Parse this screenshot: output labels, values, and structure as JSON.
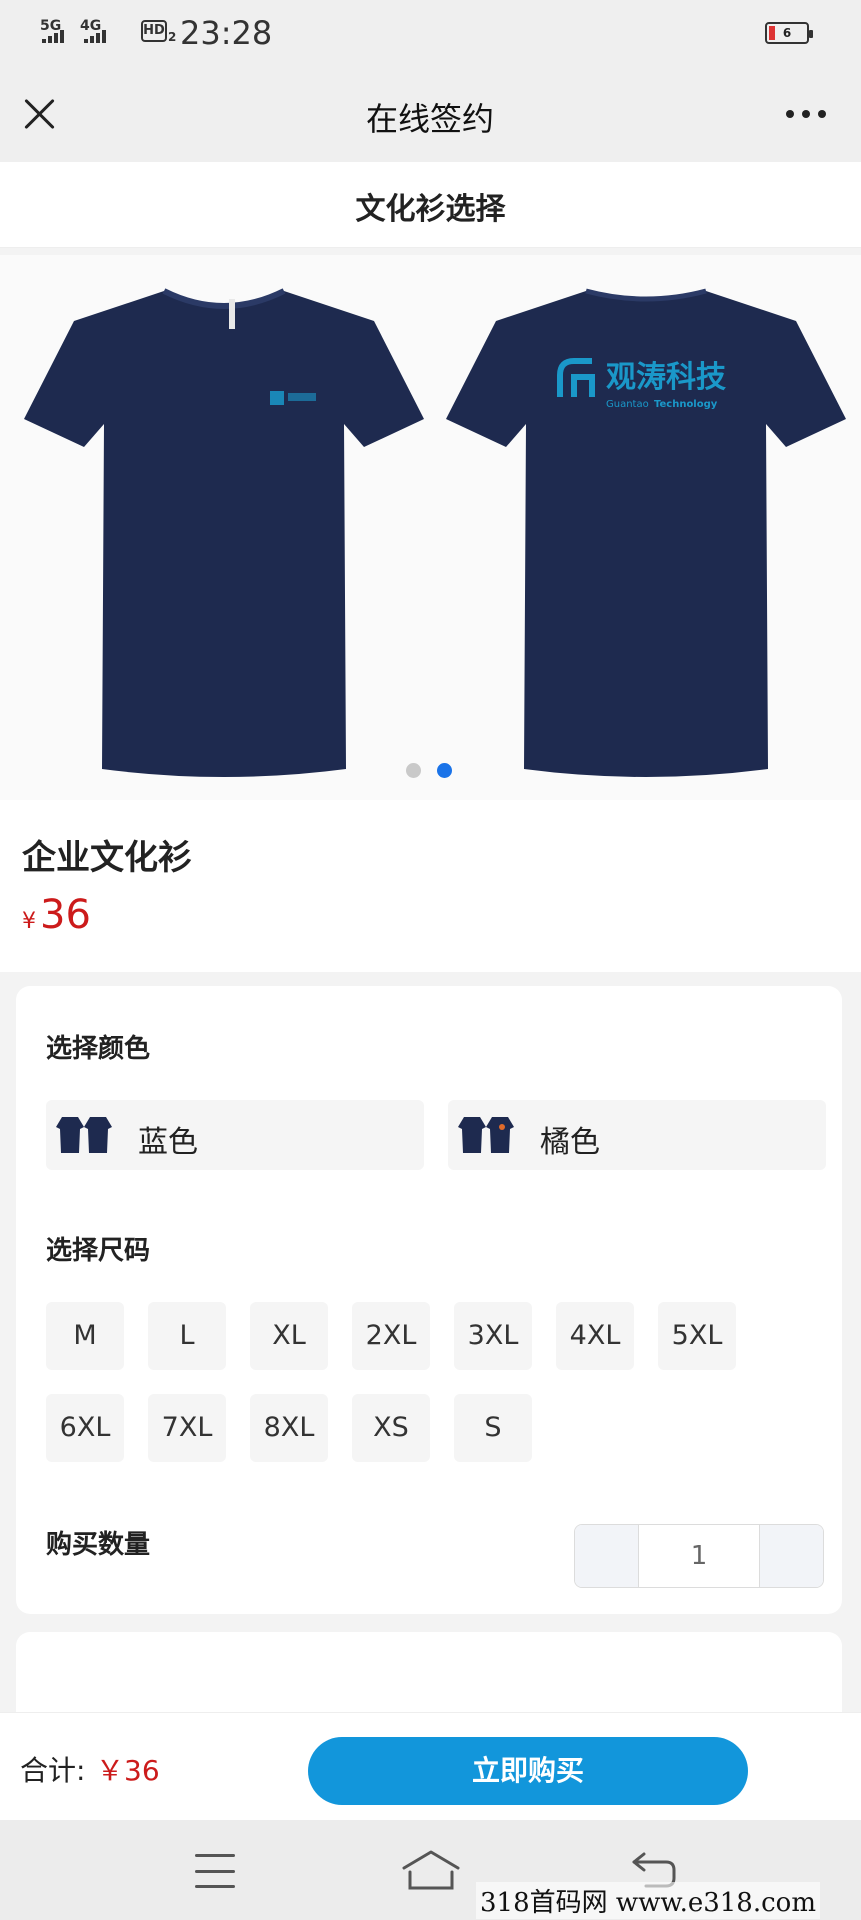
{
  "status_bar": {
    "network_1": "5G",
    "network_2": "4G",
    "hd_label": "HD",
    "hd_sub": "2",
    "time": "23:28",
    "battery_level": "6"
  },
  "nav": {
    "title": "在线签约",
    "close_icon": "close-icon",
    "more_icon": "more-dots-icon"
  },
  "section_title": "文化衫选择",
  "carousel": {
    "logo_text": "观涛科技",
    "logo_sub_a": "Guantao",
    "logo_sub_b": "Technology",
    "slide_count": 2,
    "active_slide": 2,
    "shirt_color": "#1e2a4f"
  },
  "product": {
    "name": "企业文化衫",
    "currency": "¥",
    "price": "36"
  },
  "options": {
    "color_label": "选择颜色",
    "colors": [
      {
        "label": "蓝色"
      },
      {
        "label": "橘色"
      }
    ],
    "size_label": "选择尺码",
    "sizes": [
      "M",
      "L",
      "XL",
      "2XL",
      "3XL",
      "4XL",
      "5XL",
      "6XL",
      "7XL",
      "8XL",
      "XS",
      "S"
    ],
    "quantity_label": "购买数量",
    "quantity": "1"
  },
  "footer": {
    "total_label": "合计:",
    "total_price": "￥36",
    "buy_label": "立即购买"
  },
  "system_nav": {
    "menu_icon": "menu-icon",
    "home_icon": "home-icon",
    "back_icon": "back-icon"
  },
  "watermark": "318首码网  www.e318.com",
  "colors": {
    "accent": "#1296db",
    "price": "#cc1b1b",
    "dot_active": "#1a73e8"
  }
}
